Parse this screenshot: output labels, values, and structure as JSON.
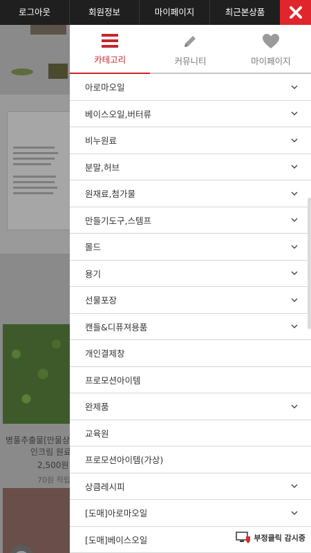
{
  "topbar": {
    "links": [
      "로그아웃",
      "회원정보",
      "마이페이지",
      "최근본상품"
    ],
    "close_icon": "close-icon"
  },
  "drawer": {
    "tabs": [
      {
        "label": "카테고리",
        "icon": "hamburger-icon",
        "active": true
      },
      {
        "label": "커뮤니티",
        "icon": "pencil-icon",
        "active": false
      },
      {
        "label": "마이페이지",
        "icon": "heart-icon",
        "active": false
      }
    ],
    "menu": [
      {
        "label": "아로마오일",
        "has_children": true
      },
      {
        "label": "베이스오일,버터류",
        "has_children": true
      },
      {
        "label": "비누원료",
        "has_children": true
      },
      {
        "label": "분말,허브",
        "has_children": true
      },
      {
        "label": "원재료,첨가물",
        "has_children": true
      },
      {
        "label": "만들기도구,스템프",
        "has_children": true
      },
      {
        "label": "몰드",
        "has_children": true
      },
      {
        "label": "용기",
        "has_children": true
      },
      {
        "label": "선물포장",
        "has_children": true
      },
      {
        "label": "캔들&디퓨져용품",
        "has_children": true
      },
      {
        "label": "개인결제창",
        "has_children": false
      },
      {
        "label": "프로모션아이템",
        "has_children": false
      },
      {
        "label": "완제품",
        "has_children": true
      },
      {
        "label": "교육원",
        "has_children": false
      },
      {
        "label": "프로모션아이템(가상)",
        "has_children": false
      },
      {
        "label": "상큼레시피",
        "has_children": true
      },
      {
        "label": "[도매]아로마오일",
        "has_children": true
      },
      {
        "label": "[도매]베이스오일",
        "has_children": true
      }
    ]
  },
  "background": {
    "product_name_1": "병풀추출물[만물상",
    "product_name_2": "인크림 원료",
    "price": "2,500원",
    "points": "70원 적립"
  },
  "badge": {
    "label": "부정클릭 감시중"
  },
  "colors": {
    "accent": "#c8242a",
    "topbar": "#1f1f1f",
    "close": "#e0262c"
  }
}
